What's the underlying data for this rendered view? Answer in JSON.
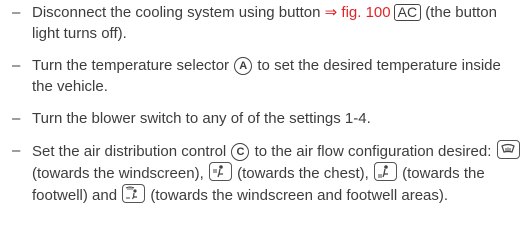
{
  "items": [
    {
      "pre": "Disconnect the cooling system using button ",
      "link": "⇒ fig. 100",
      "key": "AC",
      "post": " (the button light turns off)."
    },
    {
      "pre": "Turn the temperature selector ",
      "circle": "A",
      "post": " to set the desired temperature inside the vehicle."
    },
    {
      "text": "Turn the blower switch to any of of the settings 1-4."
    },
    {
      "pre": "Set the air distribution control ",
      "circle": "C",
      "mid": " to the air flow configuration desired: ",
      "windscreen": " (towards the windscreen), ",
      "chest": " (towards the chest),",
      "footwell": " (towards the footwell) and ",
      "both": " (towards the windscreen and footwell areas)."
    }
  ],
  "dash": "–",
  "icons": [
    "windscreen-icon",
    "chest-vent-icon",
    "footwell-vent-icon",
    "windscreen-footwell-icon"
  ],
  "colors": {
    "text": "#3d3d3d",
    "link": "#e2232a"
  }
}
